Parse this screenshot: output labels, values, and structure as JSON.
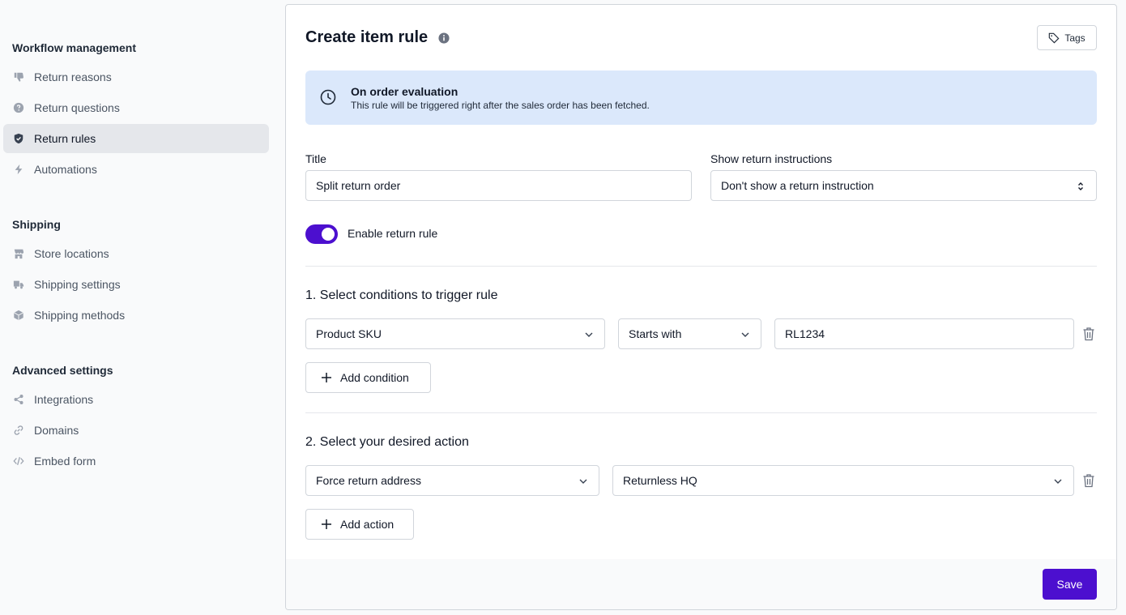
{
  "sidebar": {
    "sections": [
      {
        "title": "Workflow management",
        "items": [
          {
            "label": "Return reasons",
            "icon": "thumb-down-icon"
          },
          {
            "label": "Return questions",
            "icon": "question-circle-icon"
          },
          {
            "label": "Return rules",
            "icon": "shield-check-icon",
            "active": true
          },
          {
            "label": "Automations",
            "icon": "bolt-icon"
          }
        ]
      },
      {
        "title": "Shipping",
        "items": [
          {
            "label": "Store locations",
            "icon": "store-icon"
          },
          {
            "label": "Shipping settings",
            "icon": "truck-icon"
          },
          {
            "label": "Shipping methods",
            "icon": "cube-icon"
          }
        ]
      },
      {
        "title": "Advanced settings",
        "items": [
          {
            "label": "Integrations",
            "icon": "share-icon"
          },
          {
            "label": "Domains",
            "icon": "link-icon"
          },
          {
            "label": "Embed form",
            "icon": "code-icon"
          }
        ]
      }
    ]
  },
  "panel": {
    "title": "Create item rule",
    "tags_label": "Tags",
    "banner": {
      "title": "On order evaluation",
      "text": "This rule will be triggered right after the sales order has been fetched."
    },
    "title_field": {
      "label": "Title",
      "value": "Split return order"
    },
    "instructions_field": {
      "label": "Show return instructions",
      "value": "Don't show a return instruction"
    },
    "toggle": {
      "label": "Enable return rule",
      "enabled": true
    },
    "conditions": {
      "heading": "1. Select conditions to trigger rule",
      "field": "Product SKU",
      "operator": "Starts with",
      "value": "RL1234",
      "add_label": "Add condition"
    },
    "actions": {
      "heading": "2. Select your desired action",
      "action": "Force return address",
      "target": "Returnless HQ",
      "add_label": "Add action"
    },
    "save_label": "Save"
  },
  "colors": {
    "accent": "#4c0fcf",
    "banner_bg": "#dbe8fb",
    "active_nav_bg": "#e5e7eb"
  }
}
